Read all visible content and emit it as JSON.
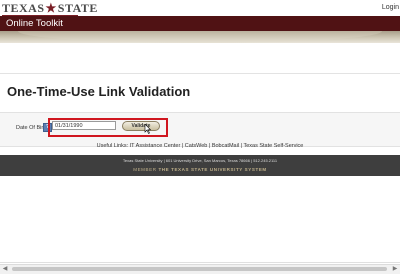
{
  "header": {
    "logo_left": "TEXAS",
    "logo_right": "STATE",
    "login": "Login"
  },
  "title_bar": {
    "title": "Online Toolkit"
  },
  "main": {
    "heading": "One-Time-Use Link Validation",
    "dob_label": "Date Of Birth",
    "help_icon": "?",
    "dob_value": "01/31/1990",
    "validate_label": "Validate"
  },
  "useful_links": {
    "prefix": "Useful Links:",
    "items": [
      "IT Assistance Center",
      "CatsWeb",
      "BobcatMail",
      "Texas State Self-Service"
    ],
    "separator": "|"
  },
  "footer": {
    "address": "Texas State University | 601 University Drive, San Marcos, Texas 78666 | 512.245.2111",
    "member_prefix": "MEMBER",
    "member_system": "THE TEXAS STATE UNIVERSITY SYSTEM"
  },
  "colors": {
    "maroon": "#501214",
    "gold": "#bfb08a",
    "highlight_red": "#d0161f"
  },
  "icons": {
    "logo_star": "star-icon",
    "help": "help-icon",
    "cursor": "cursor-icon",
    "scroll_left": "arrow-left-icon",
    "scroll_right": "arrow-right-icon"
  }
}
